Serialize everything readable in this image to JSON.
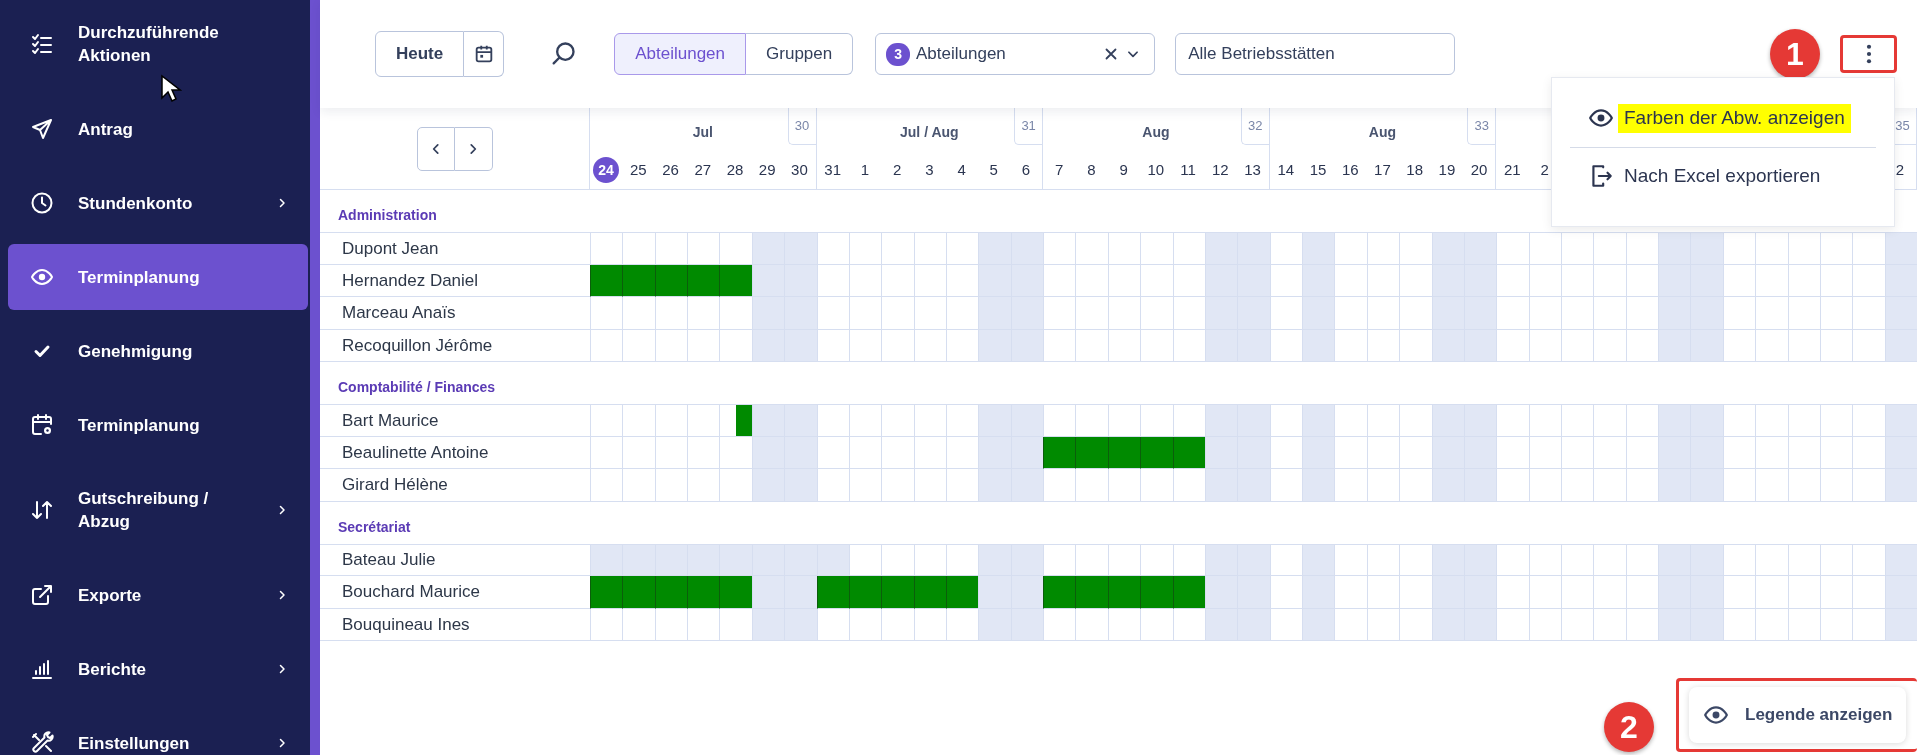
{
  "sidebar": {
    "items": [
      {
        "label": "Durchzuführende Aktionen",
        "kind": "checklist",
        "has_submenu": false,
        "selected": false
      },
      {
        "label": "Antrag",
        "kind": "send",
        "has_submenu": false,
        "selected": false
      },
      {
        "label": "Stundenkonto",
        "kind": "clock",
        "has_submenu": true,
        "selected": false
      },
      {
        "label": "Terminplanung",
        "kind": "eye",
        "has_submenu": false,
        "selected": true
      },
      {
        "label": "Genehmigung",
        "kind": "check",
        "has_submenu": false,
        "selected": false
      },
      {
        "label": "Terminplanung",
        "kind": "calendar",
        "has_submenu": false,
        "selected": false
      },
      {
        "label": "Gutschreibung / Abzug",
        "kind": "arrows",
        "has_submenu": true,
        "selected": false
      },
      {
        "label": "Exporte",
        "kind": "external",
        "has_submenu": true,
        "selected": false
      },
      {
        "label": "Berichte",
        "kind": "chart",
        "has_submenu": true,
        "selected": false
      },
      {
        "label": "Einstellungen",
        "kind": "tools",
        "has_submenu": true,
        "selected": false
      }
    ]
  },
  "toolbar": {
    "today_button": "Heute",
    "view_toggle": [
      {
        "label": "Abteilungen",
        "selected": true
      },
      {
        "label": "Gruppen",
        "selected": false
      }
    ],
    "department_filter": {
      "count": "3",
      "label": "Abteilungen"
    },
    "site_filter": {
      "value": "Alle Betriebsstätten"
    },
    "callout": {
      "number": "1"
    }
  },
  "more_menu": {
    "items": [
      {
        "label": "Farben der Abw. anzeigen",
        "kind": "eye",
        "highlighted": true
      },
      {
        "label": "Nach Excel exportieren",
        "kind": "export",
        "highlighted": false
      }
    ]
  },
  "calendar": {
    "weeks": [
      {
        "month": "Jul",
        "number": "30",
        "days": [
          {
            "label": "24",
            "today": true
          },
          {
            "label": "25",
            "today": false
          },
          {
            "label": "26",
            "today": false
          },
          {
            "label": "27",
            "today": false
          },
          {
            "label": "28",
            "today": false
          },
          {
            "label": "29",
            "today": false
          },
          {
            "label": "30",
            "today": false
          }
        ]
      },
      {
        "month": "Jul / Aug",
        "number": "31",
        "days": [
          {
            "label": "31",
            "today": false
          },
          {
            "label": "1",
            "today": false
          },
          {
            "label": "2",
            "today": false
          },
          {
            "label": "3",
            "today": false
          },
          {
            "label": "4",
            "today": false
          },
          {
            "label": "5",
            "today": false
          },
          {
            "label": "6",
            "today": false
          }
        ]
      },
      {
        "month": "Aug",
        "number": "32",
        "days": [
          {
            "label": "7",
            "today": false
          },
          {
            "label": "8",
            "today": false
          },
          {
            "label": "9",
            "today": false
          },
          {
            "label": "10",
            "today": false
          },
          {
            "label": "11",
            "today": false
          },
          {
            "label": "12",
            "today": false
          },
          {
            "label": "13",
            "today": false
          }
        ]
      },
      {
        "month": "Aug",
        "number": "33",
        "days": [
          {
            "label": "14",
            "today": false
          },
          {
            "label": "15",
            "today": false
          },
          {
            "label": "16",
            "today": false
          },
          {
            "label": "17",
            "today": false
          },
          {
            "label": "18",
            "today": false
          },
          {
            "label": "19",
            "today": false
          },
          {
            "label": "20",
            "today": false
          }
        ]
      },
      {
        "days": [
          {
            "label": "21",
            "today": false
          },
          {
            "label": "2",
            "today": false
          }
        ]
      },
      {
        "number": "35",
        "days": [
          {
            "label": "2",
            "today": false
          }
        ]
      }
    ],
    "groups": [
      {
        "name": "Administration",
        "employees": [
          {
            "name": "Dupont Jean",
            "cells": [
              {
                "kind": "work"
              },
              {
                "kind": "work"
              },
              {
                "kind": "work"
              },
              {
                "kind": "work"
              },
              {
                "kind": "work"
              },
              {
                "kind": "off"
              },
              {
                "kind": "off"
              },
              {
                "kind": "work"
              },
              {
                "kind": "work"
              },
              {
                "kind": "work"
              },
              {
                "kind": "work"
              },
              {
                "kind": "work"
              },
              {
                "kind": "off"
              },
              {
                "kind": "off"
              },
              {
                "kind": "work"
              },
              {
                "kind": "work"
              },
              {
                "kind": "work"
              },
              {
                "kind": "work"
              },
              {
                "kind": "work"
              },
              {
                "kind": "off"
              },
              {
                "kind": "off"
              },
              {
                "kind": "work"
              },
              {
                "kind": "off"
              },
              {
                "kind": "work"
              },
              {
                "kind": "work"
              },
              {
                "kind": "work"
              },
              {
                "kind": "off"
              },
              {
                "kind": "off"
              },
              {
                "kind": "work"
              },
              {
                "kind": "work"
              },
              {
                "kind": "work"
              },
              {
                "kind": "work"
              },
              {
                "kind": "work"
              },
              {
                "kind": "off"
              },
              {
                "kind": "off"
              },
              {
                "kind": "work"
              },
              {
                "kind": "work"
              },
              {
                "kind": "work"
              },
              {
                "kind": "work"
              },
              {
                "kind": "work"
              },
              {
                "kind": "off"
              }
            ]
          },
          {
            "name": "Hernandez Daniel",
            "cells": [
              {
                "kind": "absent"
              },
              {
                "kind": "absent"
              },
              {
                "kind": "absent"
              },
              {
                "kind": "absent"
              },
              {
                "kind": "absent"
              },
              {
                "kind": "off"
              },
              {
                "kind": "off"
              },
              {
                "kind": "work"
              },
              {
                "kind": "work"
              },
              {
                "kind": "work"
              },
              {
                "kind": "work"
              },
              {
                "kind": "work"
              },
              {
                "kind": "off"
              },
              {
                "kind": "off"
              },
              {
                "kind": "work"
              },
              {
                "kind": "work"
              },
              {
                "kind": "work"
              },
              {
                "kind": "work"
              },
              {
                "kind": "work"
              },
              {
                "kind": "off"
              },
              {
                "kind": "off"
              },
              {
                "kind": "work"
              },
              {
                "kind": "off"
              },
              {
                "kind": "work"
              },
              {
                "kind": "work"
              },
              {
                "kind": "work"
              },
              {
                "kind": "off"
              },
              {
                "kind": "off"
              },
              {
                "kind": "work"
              },
              {
                "kind": "work"
              },
              {
                "kind": "work"
              },
              {
                "kind": "work"
              },
              {
                "kind": "work"
              },
              {
                "kind": "off"
              },
              {
                "kind": "off"
              },
              {
                "kind": "work"
              },
              {
                "kind": "work"
              },
              {
                "kind": "work"
              },
              {
                "kind": "work"
              },
              {
                "kind": "work"
              },
              {
                "kind": "off"
              }
            ]
          },
          {
            "name": "Marceau Anaïs",
            "cells": [
              {
                "kind": "work"
              },
              {
                "kind": "work"
              },
              {
                "kind": "work"
              },
              {
                "kind": "work"
              },
              {
                "kind": "work"
              },
              {
                "kind": "off"
              },
              {
                "kind": "off"
              },
              {
                "kind": "work"
              },
              {
                "kind": "work"
              },
              {
                "kind": "work"
              },
              {
                "kind": "work"
              },
              {
                "kind": "work"
              },
              {
                "kind": "off"
              },
              {
                "kind": "off"
              },
              {
                "kind": "work"
              },
              {
                "kind": "work"
              },
              {
                "kind": "work"
              },
              {
                "kind": "work"
              },
              {
                "kind": "work"
              },
              {
                "kind": "off"
              },
              {
                "kind": "off"
              },
              {
                "kind": "work"
              },
              {
                "kind": "off"
              },
              {
                "kind": "work"
              },
              {
                "kind": "work"
              },
              {
                "kind": "work"
              },
              {
                "kind": "off"
              },
              {
                "kind": "off"
              },
              {
                "kind": "work"
              },
              {
                "kind": "work"
              },
              {
                "kind": "work"
              },
              {
                "kind": "work"
              },
              {
                "kind": "work"
              },
              {
                "kind": "off"
              },
              {
                "kind": "off"
              },
              {
                "kind": "work"
              },
              {
                "kind": "work"
              },
              {
                "kind": "work"
              },
              {
                "kind": "work"
              },
              {
                "kind": "work"
              },
              {
                "kind": "off"
              }
            ]
          },
          {
            "name": "Recoquillon Jérôme",
            "cells": [
              {
                "kind": "work"
              },
              {
                "kind": "work"
              },
              {
                "kind": "work"
              },
              {
                "kind": "work"
              },
              {
                "kind": "work"
              },
              {
                "kind": "off"
              },
              {
                "kind": "off"
              },
              {
                "kind": "work"
              },
              {
                "kind": "work"
              },
              {
                "kind": "work"
              },
              {
                "kind": "work"
              },
              {
                "kind": "work"
              },
              {
                "kind": "off"
              },
              {
                "kind": "off"
              },
              {
                "kind": "work"
              },
              {
                "kind": "work"
              },
              {
                "kind": "work"
              },
              {
                "kind": "work"
              },
              {
                "kind": "work"
              },
              {
                "kind": "off"
              },
              {
                "kind": "off"
              },
              {
                "kind": "work"
              },
              {
                "kind": "off"
              },
              {
                "kind": "work"
              },
              {
                "kind": "work"
              },
              {
                "kind": "work"
              },
              {
                "kind": "off"
              },
              {
                "kind": "off"
              },
              {
                "kind": "work"
              },
              {
                "kind": "work"
              },
              {
                "kind": "work"
              },
              {
                "kind": "work"
              },
              {
                "kind": "work"
              },
              {
                "kind": "off"
              },
              {
                "kind": "off"
              },
              {
                "kind": "work"
              },
              {
                "kind": "work"
              },
              {
                "kind": "work"
              },
              {
                "kind": "work"
              },
              {
                "kind": "work"
              },
              {
                "kind": "off"
              }
            ]
          }
        ]
      },
      {
        "name": "Comptabilité / Finances",
        "employees": [
          {
            "name": "Bart Maurice",
            "cells": [
              {
                "kind": "work"
              },
              {
                "kind": "work"
              },
              {
                "kind": "work"
              },
              {
                "kind": "work"
              },
              {
                "kind": "halfday"
              },
              {
                "kind": "off"
              },
              {
                "kind": "off"
              },
              {
                "kind": "work"
              },
              {
                "kind": "work"
              },
              {
                "kind": "work"
              },
              {
                "kind": "work"
              },
              {
                "kind": "work"
              },
              {
                "kind": "off"
              },
              {
                "kind": "off"
              },
              {
                "kind": "work"
              },
              {
                "kind": "work"
              },
              {
                "kind": "work"
              },
              {
                "kind": "work"
              },
              {
                "kind": "work"
              },
              {
                "kind": "off"
              },
              {
                "kind": "off"
              },
              {
                "kind": "work"
              },
              {
                "kind": "off"
              },
              {
                "kind": "work"
              },
              {
                "kind": "work"
              },
              {
                "kind": "work"
              },
              {
                "kind": "off"
              },
              {
                "kind": "off"
              },
              {
                "kind": "work"
              },
              {
                "kind": "work"
              },
              {
                "kind": "work"
              },
              {
                "kind": "work"
              },
              {
                "kind": "work"
              },
              {
                "kind": "off"
              },
              {
                "kind": "off"
              },
              {
                "kind": "work"
              },
              {
                "kind": "work"
              },
              {
                "kind": "work"
              },
              {
                "kind": "work"
              },
              {
                "kind": "work"
              },
              {
                "kind": "off"
              }
            ]
          },
          {
            "name": "Beaulinette Antoine",
            "cells": [
              {
                "kind": "work"
              },
              {
                "kind": "work"
              },
              {
                "kind": "work"
              },
              {
                "kind": "work"
              },
              {
                "kind": "work"
              },
              {
                "kind": "off"
              },
              {
                "kind": "off"
              },
              {
                "kind": "work"
              },
              {
                "kind": "work"
              },
              {
                "kind": "work"
              },
              {
                "kind": "work"
              },
              {
                "kind": "work"
              },
              {
                "kind": "off"
              },
              {
                "kind": "off"
              },
              {
                "kind": "absent"
              },
              {
                "kind": "absent"
              },
              {
                "kind": "absent"
              },
              {
                "kind": "absent"
              },
              {
                "kind": "absent"
              },
              {
                "kind": "off"
              },
              {
                "kind": "off"
              },
              {
                "kind": "work"
              },
              {
                "kind": "off"
              },
              {
                "kind": "work"
              },
              {
                "kind": "work"
              },
              {
                "kind": "work"
              },
              {
                "kind": "off"
              },
              {
                "kind": "off"
              },
              {
                "kind": "work"
              },
              {
                "kind": "work"
              },
              {
                "kind": "work"
              },
              {
                "kind": "work"
              },
              {
                "kind": "work"
              },
              {
                "kind": "off"
              },
              {
                "kind": "off"
              },
              {
                "kind": "work"
              },
              {
                "kind": "work"
              },
              {
                "kind": "work"
              },
              {
                "kind": "work"
              },
              {
                "kind": "work"
              },
              {
                "kind": "off"
              }
            ]
          },
          {
            "name": "Girard Hélène",
            "cells": [
              {
                "kind": "work"
              },
              {
                "kind": "work"
              },
              {
                "kind": "work"
              },
              {
                "kind": "work"
              },
              {
                "kind": "work"
              },
              {
                "kind": "off"
              },
              {
                "kind": "off"
              },
              {
                "kind": "work"
              },
              {
                "kind": "work"
              },
              {
                "kind": "work"
              },
              {
                "kind": "work"
              },
              {
                "kind": "work"
              },
              {
                "kind": "off"
              },
              {
                "kind": "off"
              },
              {
                "kind": "work"
              },
              {
                "kind": "work"
              },
              {
                "kind": "work"
              },
              {
                "kind": "work"
              },
              {
                "kind": "work"
              },
              {
                "kind": "off"
              },
              {
                "kind": "off"
              },
              {
                "kind": "work"
              },
              {
                "kind": "off"
              },
              {
                "kind": "work"
              },
              {
                "kind": "work"
              },
              {
                "kind": "work"
              },
              {
                "kind": "off"
              },
              {
                "kind": "off"
              },
              {
                "kind": "work"
              },
              {
                "kind": "work"
              },
              {
                "kind": "work"
              },
              {
                "kind": "work"
              },
              {
                "kind": "work"
              },
              {
                "kind": "off"
              },
              {
                "kind": "off"
              },
              {
                "kind": "work"
              },
              {
                "kind": "work"
              },
              {
                "kind": "work"
              },
              {
                "kind": "work"
              },
              {
                "kind": "work"
              },
              {
                "kind": "off"
              }
            ]
          }
        ]
      },
      {
        "name": "Secrétariat",
        "employees": [
          {
            "name": "Bateau Julie",
            "cells": [
              {
                "kind": "off"
              },
              {
                "kind": "off"
              },
              {
                "kind": "off"
              },
              {
                "kind": "off"
              },
              {
                "kind": "off"
              },
              {
                "kind": "off"
              },
              {
                "kind": "off"
              },
              {
                "kind": "off"
              },
              {
                "kind": "work"
              },
              {
                "kind": "work"
              },
              {
                "kind": "work"
              },
              {
                "kind": "work"
              },
              {
                "kind": "off"
              },
              {
                "kind": "off"
              },
              {
                "kind": "work"
              },
              {
                "kind": "work"
              },
              {
                "kind": "work"
              },
              {
                "kind": "work"
              },
              {
                "kind": "work"
              },
              {
                "kind": "off"
              },
              {
                "kind": "off"
              },
              {
                "kind": "work"
              },
              {
                "kind": "off"
              },
              {
                "kind": "work"
              },
              {
                "kind": "work"
              },
              {
                "kind": "work"
              },
              {
                "kind": "off"
              },
              {
                "kind": "off"
              },
              {
                "kind": "work"
              },
              {
                "kind": "work"
              },
              {
                "kind": "work"
              },
              {
                "kind": "work"
              },
              {
                "kind": "work"
              },
              {
                "kind": "off"
              },
              {
                "kind": "off"
              },
              {
                "kind": "work"
              },
              {
                "kind": "work"
              },
              {
                "kind": "work"
              },
              {
                "kind": "work"
              },
              {
                "kind": "work"
              },
              {
                "kind": "off"
              }
            ]
          },
          {
            "name": "Bouchard Maurice",
            "cells": [
              {
                "kind": "absent"
              },
              {
                "kind": "absent"
              },
              {
                "kind": "absent"
              },
              {
                "kind": "absent"
              },
              {
                "kind": "absent"
              },
              {
                "kind": "off"
              },
              {
                "kind": "off"
              },
              {
                "kind": "absent"
              },
              {
                "kind": "absent"
              },
              {
                "kind": "absent"
              },
              {
                "kind": "absent"
              },
              {
                "kind": "absent"
              },
              {
                "kind": "off"
              },
              {
                "kind": "off"
              },
              {
                "kind": "absent"
              },
              {
                "kind": "absent"
              },
              {
                "kind": "absent"
              },
              {
                "kind": "absent"
              },
              {
                "kind": "absent"
              },
              {
                "kind": "off"
              },
              {
                "kind": "off"
              },
              {
                "kind": "work"
              },
              {
                "kind": "off"
              },
              {
                "kind": "work"
              },
              {
                "kind": "work"
              },
              {
                "kind": "work"
              },
              {
                "kind": "off"
              },
              {
                "kind": "off"
              },
              {
                "kind": "work"
              },
              {
                "kind": "work"
              },
              {
                "kind": "work"
              },
              {
                "kind": "work"
              },
              {
                "kind": "work"
              },
              {
                "kind": "off"
              },
              {
                "kind": "off"
              },
              {
                "kind": "work"
              },
              {
                "kind": "work"
              },
              {
                "kind": "work"
              },
              {
                "kind": "work"
              },
              {
                "kind": "work"
              },
              {
                "kind": "off"
              }
            ]
          },
          {
            "name": "Bouquineau Ines",
            "cells": [
              {
                "kind": "work"
              },
              {
                "kind": "work"
              },
              {
                "kind": "work"
              },
              {
                "kind": "work"
              },
              {
                "kind": "work"
              },
              {
                "kind": "off"
              },
              {
                "kind": "off"
              },
              {
                "kind": "work"
              },
              {
                "kind": "work"
              },
              {
                "kind": "work"
              },
              {
                "kind": "work"
              },
              {
                "kind": "work"
              },
              {
                "kind": "off"
              },
              {
                "kind": "off"
              },
              {
                "kind": "work"
              },
              {
                "kind": "work"
              },
              {
                "kind": "work"
              },
              {
                "kind": "work"
              },
              {
                "kind": "work"
              },
              {
                "kind": "off"
              },
              {
                "kind": "off"
              },
              {
                "kind": "work"
              },
              {
                "kind": "off"
              },
              {
                "kind": "work"
              },
              {
                "kind": "work"
              },
              {
                "kind": "work"
              },
              {
                "kind": "off"
              },
              {
                "kind": "off"
              },
              {
                "kind": "work"
              },
              {
                "kind": "work"
              },
              {
                "kind": "work"
              },
              {
                "kind": "work"
              },
              {
                "kind": "work"
              },
              {
                "kind": "off"
              },
              {
                "kind": "off"
              },
              {
                "kind": "work"
              },
              {
                "kind": "work"
              },
              {
                "kind": "work"
              },
              {
                "kind": "work"
              },
              {
                "kind": "work"
              },
              {
                "kind": "off"
              }
            ]
          }
        ]
      }
    ]
  },
  "legend": {
    "button": "Legende anzeigen",
    "callout": {
      "number": "2"
    }
  }
}
